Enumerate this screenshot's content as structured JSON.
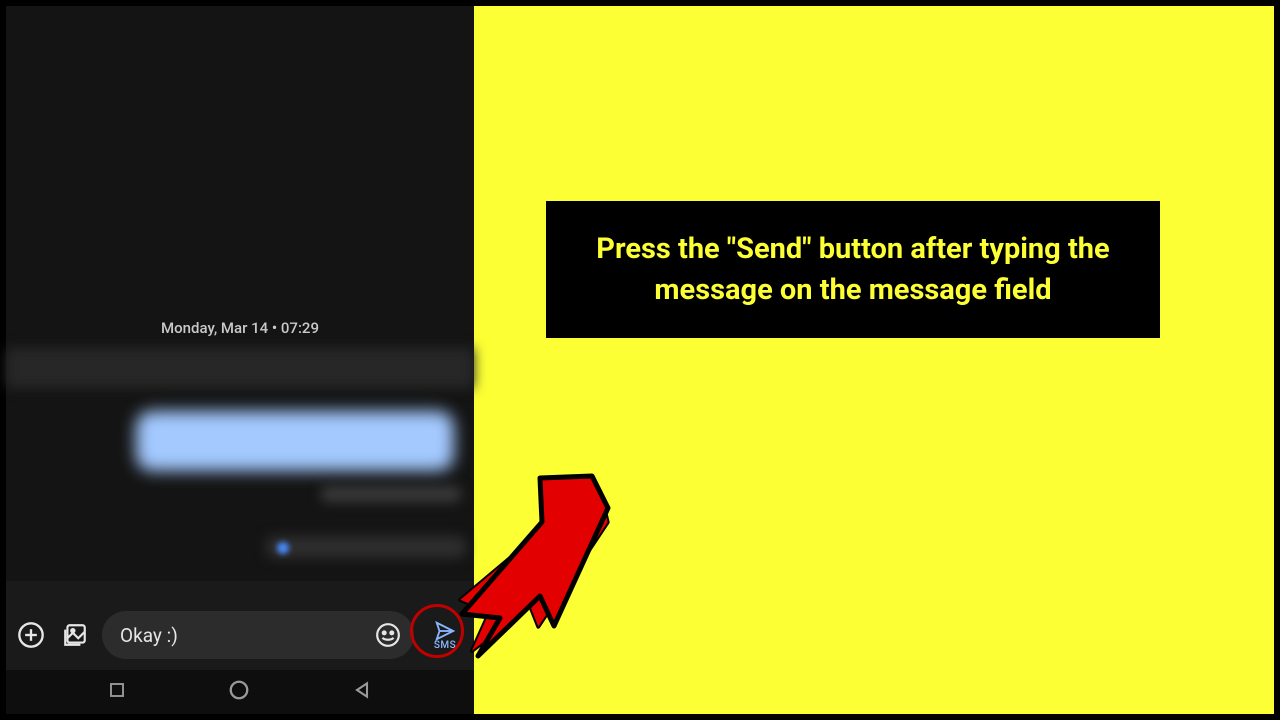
{
  "conversation": {
    "date_divider": "Monday, Mar 14 • 07:29"
  },
  "compose": {
    "input_value": "Okay :)",
    "send_label": "SMS"
  },
  "callout": {
    "text": "Press the \"Send\" button after typing the message on the message field"
  },
  "icons": {
    "add": "add-circle-icon",
    "gallery": "gallery-icon",
    "emoji": "emoji-icon",
    "send": "send-icon",
    "nav_recent": "square-icon",
    "nav_home": "circle-icon",
    "nav_back": "triangle-back-icon"
  }
}
